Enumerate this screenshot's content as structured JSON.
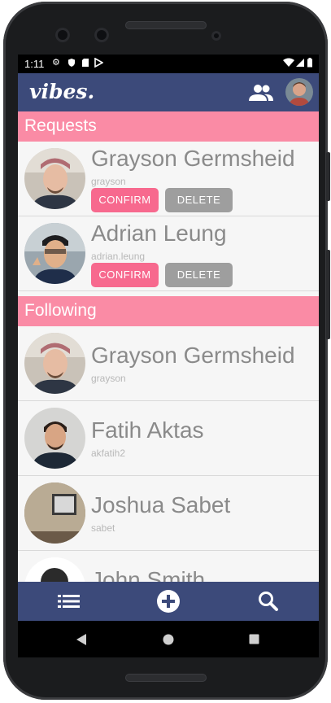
{
  "status_bar": {
    "time": "1:11"
  },
  "app_bar": {
    "logo": "vibes.",
    "icons": [
      "people-icon",
      "profile-avatar"
    ]
  },
  "requests": {
    "title": "Requests",
    "items": [
      {
        "name": "Grayson Germsheid",
        "username": "grayson",
        "confirm_label": "CONFIRM",
        "delete_label": "DELETE"
      },
      {
        "name": "Adrian Leung",
        "username": "adrian.leung",
        "confirm_label": "CONFIRM",
        "delete_label": "DELETE"
      }
    ]
  },
  "following": {
    "title": "Following",
    "items": [
      {
        "name": "Grayson Germsheid",
        "username": "grayson"
      },
      {
        "name": "Fatih Aktas",
        "username": "akfatih2"
      },
      {
        "name": "Joshua Sabet",
        "username": "sabet"
      },
      {
        "name": "John Smith",
        "username": ""
      }
    ]
  },
  "bottom_nav": {
    "items": [
      "list-icon",
      "add-icon",
      "search-icon"
    ]
  },
  "colors": {
    "header": "#3c4a7a",
    "section": "#fa8ba5",
    "confirm": "#f7698e",
    "delete": "#9e9e9e"
  }
}
